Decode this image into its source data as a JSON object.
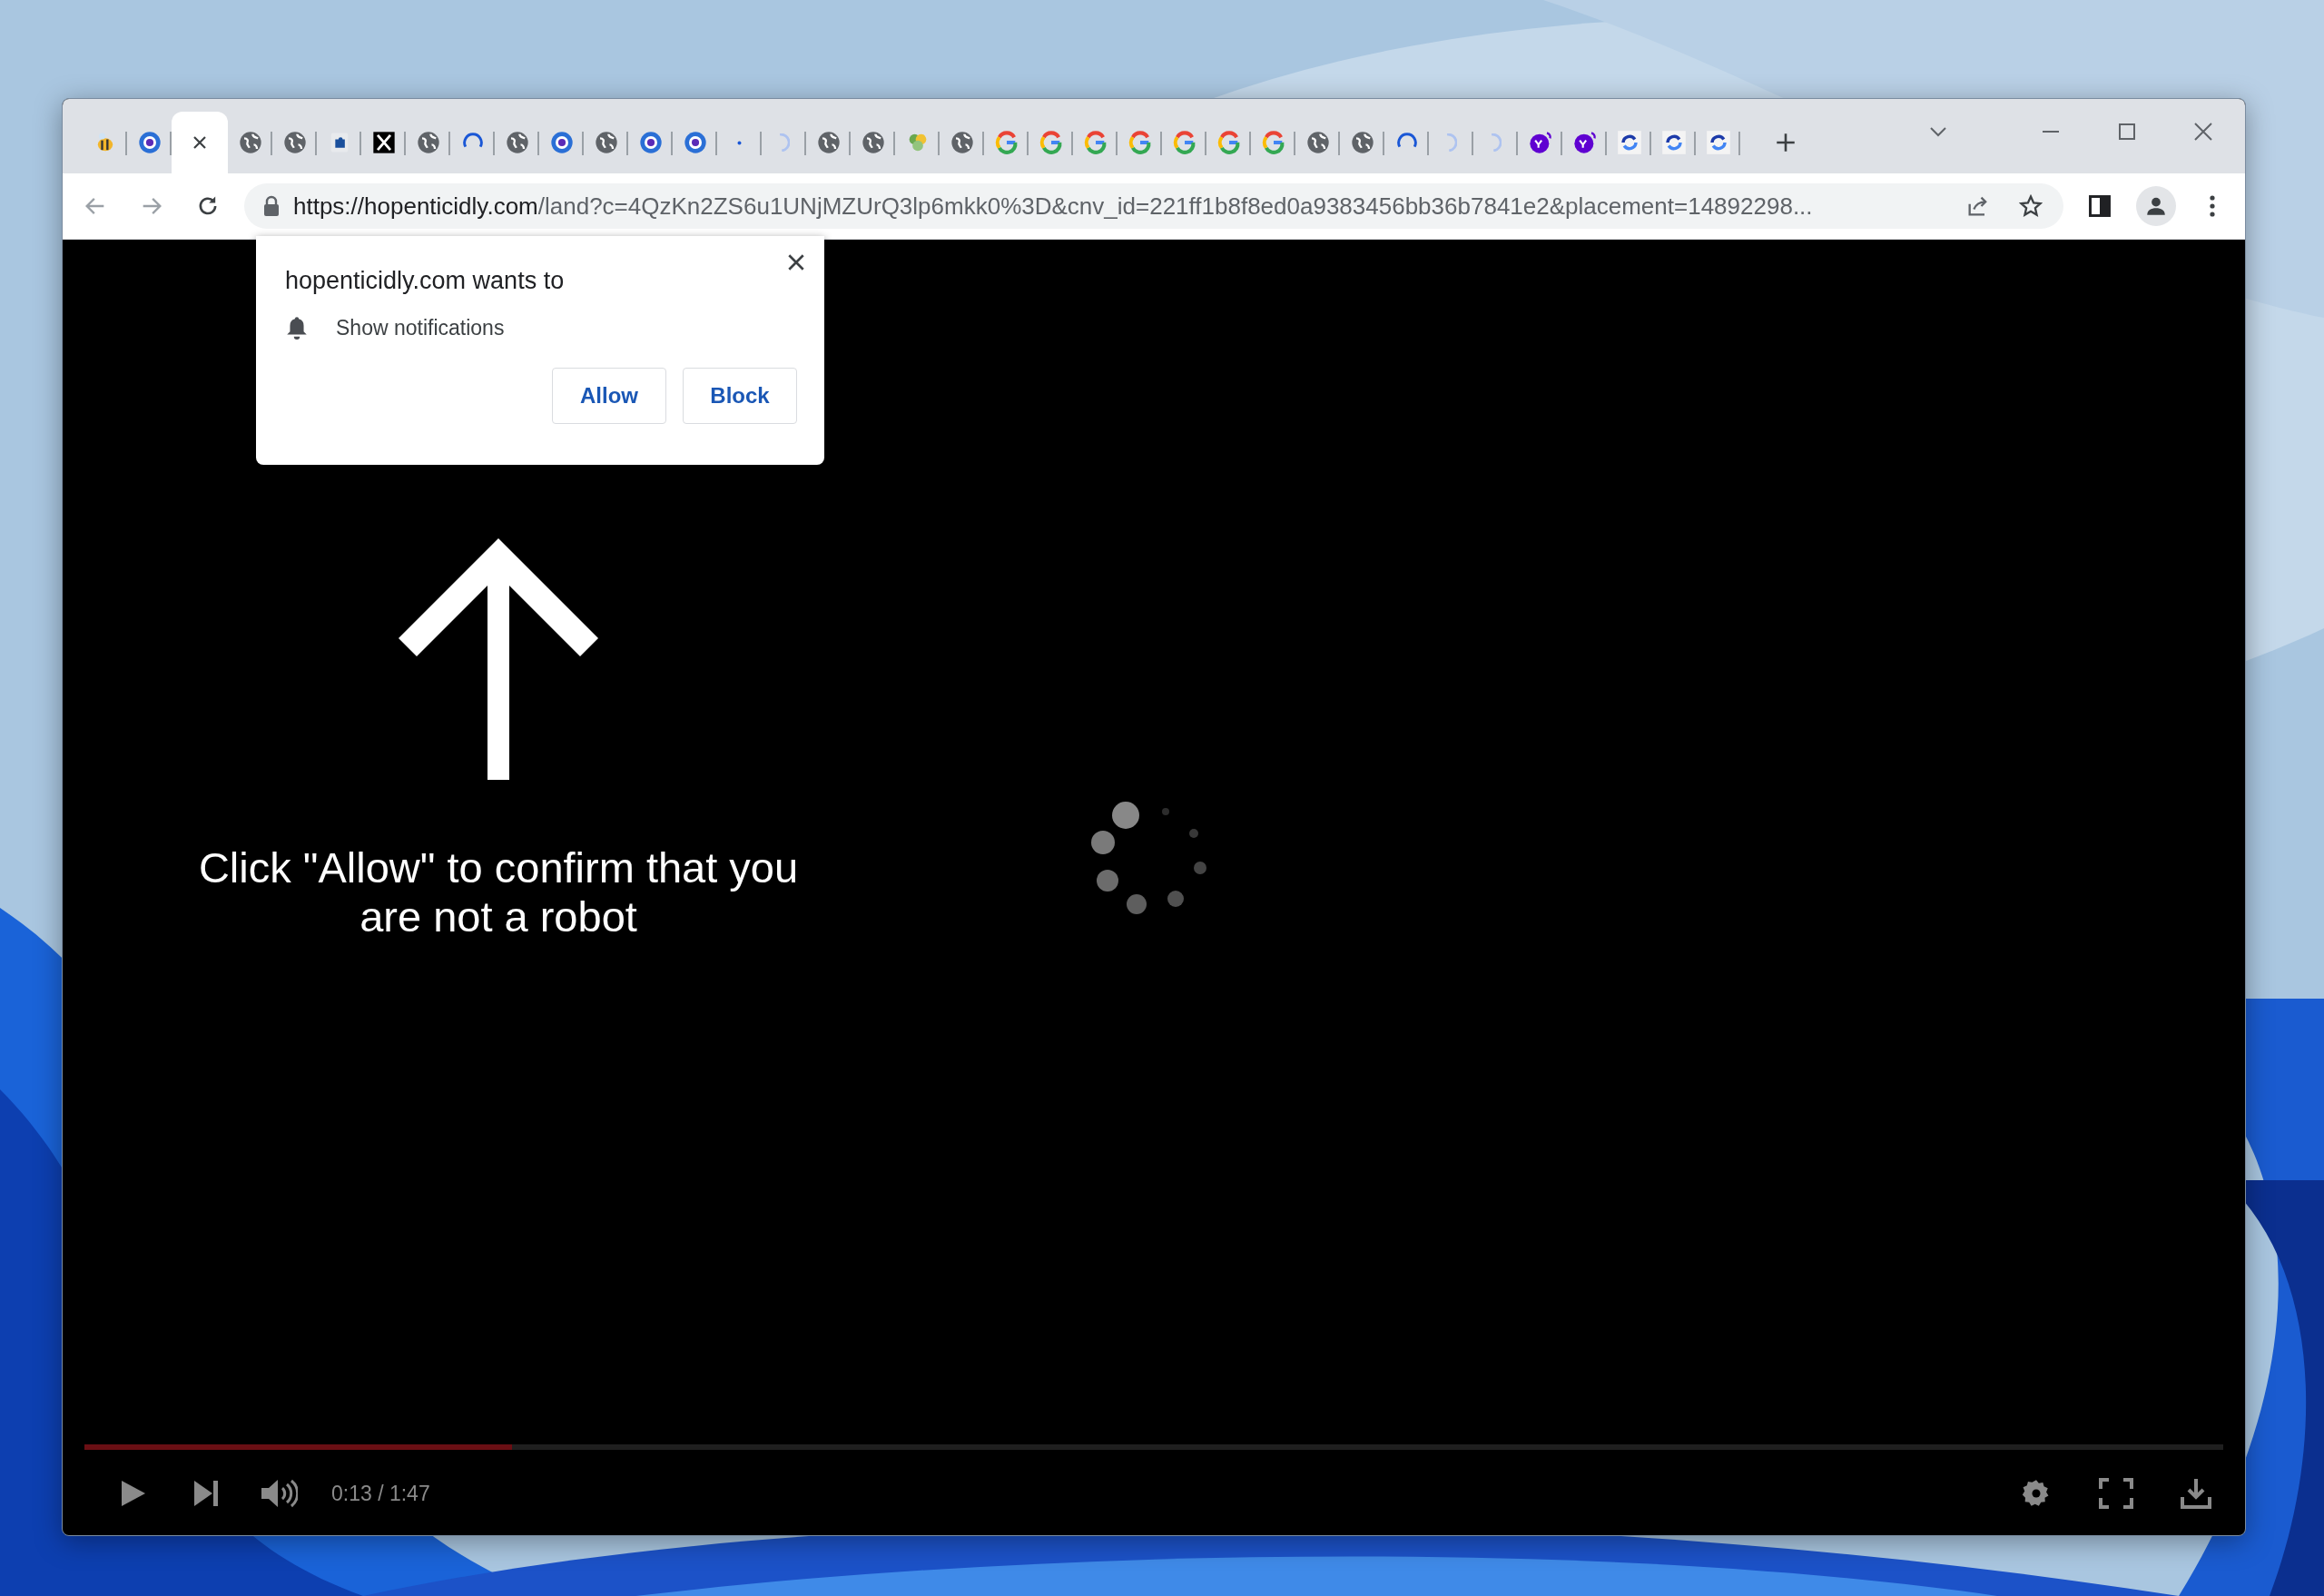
{
  "tabs": [
    {
      "kind": "bee",
      "selected": false
    },
    {
      "kind": "swirl",
      "selected": false
    },
    {
      "selected": true
    },
    {
      "kind": "globe",
      "selected": false
    },
    {
      "kind": "globe",
      "selected": false
    },
    {
      "kind": "puzzle",
      "selected": false
    },
    {
      "kind": "x",
      "selected": false
    },
    {
      "kind": "globe",
      "selected": false
    },
    {
      "kind": "arc",
      "selected": false
    },
    {
      "kind": "globe",
      "selected": false
    },
    {
      "kind": "swirl",
      "selected": false
    },
    {
      "kind": "globe",
      "selected": false
    },
    {
      "kind": "swirl",
      "selected": false
    },
    {
      "kind": "swirl",
      "selected": false
    },
    {
      "kind": "dot",
      "selected": false
    },
    {
      "kind": "faint-arc",
      "selected": false
    },
    {
      "kind": "globe",
      "selected": false
    },
    {
      "kind": "globe",
      "selected": false
    },
    {
      "kind": "flower",
      "selected": false
    },
    {
      "kind": "globe",
      "selected": false
    },
    {
      "kind": "google",
      "selected": false
    },
    {
      "kind": "google",
      "selected": false
    },
    {
      "kind": "google",
      "selected": false
    },
    {
      "kind": "google",
      "selected": false
    },
    {
      "kind": "google",
      "selected": false
    },
    {
      "kind": "google",
      "selected": false
    },
    {
      "kind": "google",
      "selected": false
    },
    {
      "kind": "globe",
      "selected": false
    },
    {
      "kind": "globe",
      "selected": false
    },
    {
      "kind": "arc",
      "selected": false
    },
    {
      "kind": "faint-arc",
      "selected": false
    },
    {
      "kind": "faint-arc",
      "selected": false
    },
    {
      "kind": "yahoo",
      "selected": false
    },
    {
      "kind": "yahoo",
      "selected": false
    },
    {
      "kind": "recaptcha",
      "selected": false
    },
    {
      "kind": "recaptcha",
      "selected": false
    },
    {
      "kind": "recaptcha",
      "selected": false
    }
  ],
  "address_bar": {
    "url_host": "https://hopenticidly.com",
    "url_rest": "/land?c=4QzKn2ZS6u1UNjMZUrQ3lp6mkk0%3D&cnv_id=221ff1b8f8ed0a9383456bb36b7841e2&placement=14892298..."
  },
  "permission_popup": {
    "title": "hopenticidly.com wants to",
    "permission": "Show notifications",
    "buttons": [
      "Allow",
      "Block"
    ]
  },
  "page": {
    "instruction": "Click \"Allow\" to confirm that you are not a robot"
  },
  "player": {
    "progress": {
      "level": 0.2
    },
    "time": "0:13 / 1:47"
  }
}
